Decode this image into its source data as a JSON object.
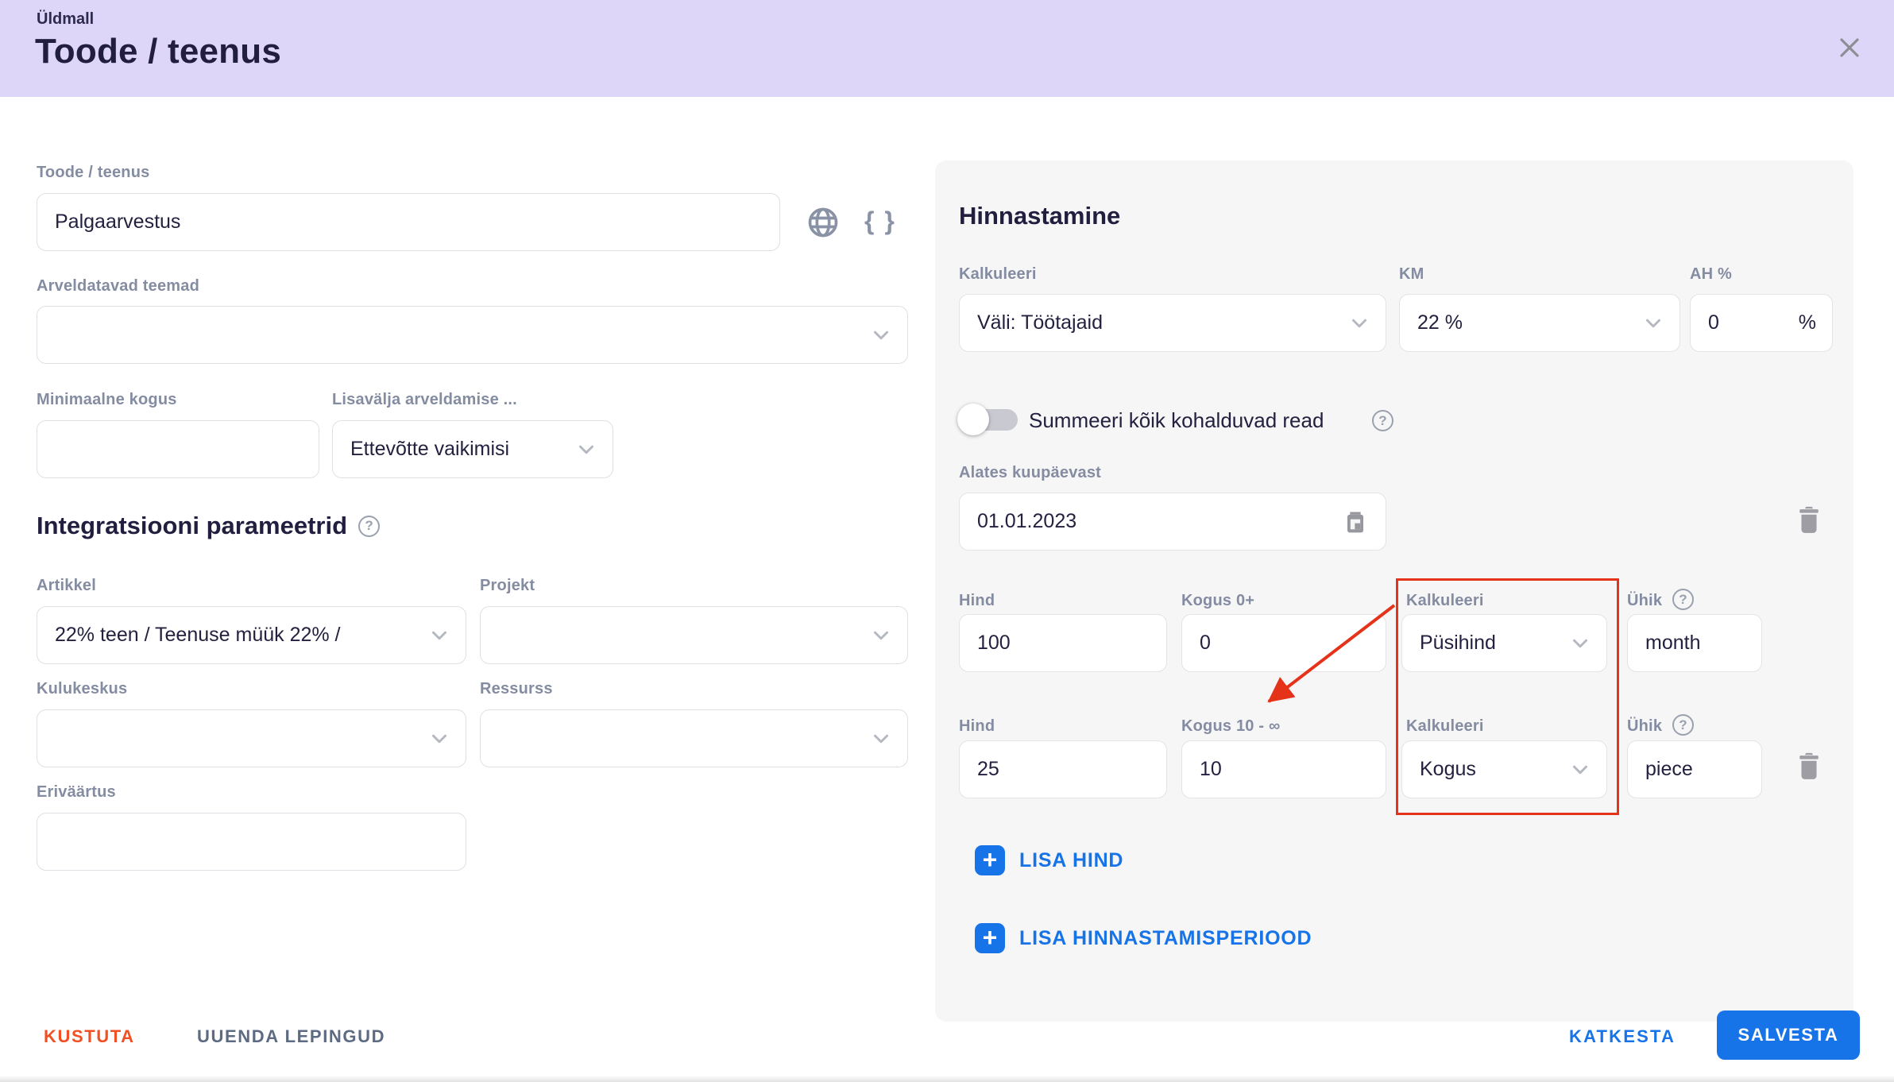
{
  "header": {
    "eyebrow": "Üldmall",
    "title": "Toode / teenus"
  },
  "icons": {
    "help_glyph": "?",
    "braces_glyph": "{ }"
  },
  "left_form": {
    "product_label": "Toode / teenus",
    "product_value": "Palgaarvestus",
    "billable_topics_label": "Arveldatavad teemad",
    "billable_topics_value": "",
    "min_quantity_label": "Minimaalne kogus",
    "min_quantity_value": "",
    "extra_field_label": "Lisavälja arveldamise ...",
    "extra_field_value": "Ettevõtte vaikimisi",
    "integration_heading": "Integratsiooni parameetrid",
    "artikkel_label": "Artikkel",
    "artikkel_value": "22% teen / Teenuse müük 22% /",
    "projekt_label": "Projekt",
    "projekt_value": "",
    "kulukeskus_label": "Kulukeskus",
    "kulukeskus_value": "",
    "ressurss_label": "Ressurss",
    "ressurss_value": "",
    "erivaartus_label": "Eriväärtus",
    "erivaartus_value": ""
  },
  "pricing": {
    "heading": "Hinnastamine",
    "kalkuleeri_label": "Kalkuleeri",
    "kalkuleeri_value": "Väli: Töötajaid",
    "km_label": "KM",
    "km_value": "22 %",
    "ah_label": "AH %",
    "ah_value": "0",
    "ah_suffix": "%",
    "toggle_label": "Summeeri kõik kohalduvad read",
    "date_label": "Alates kuupäevast",
    "date_value": "01.01.2023",
    "rows": [
      {
        "hind_label": "Hind",
        "hind": "100",
        "kogus_label": "Kogus 0+",
        "kogus": "0",
        "kalkuleeri_label": "Kalkuleeri",
        "kalkuleeri": "Püsihind",
        "yhik_label": "Ühik",
        "yhik": "month"
      },
      {
        "hind_label": "Hind",
        "hind": "25",
        "kogus_label": "Kogus 10 - ∞",
        "kogus": "10",
        "kalkuleeri_label": "Kalkuleeri",
        "kalkuleeri": "Kogus",
        "yhik_label": "Ühik",
        "yhik": "piece"
      }
    ],
    "add_price_label": "LISA HIND",
    "add_period_label": "LISA HINNASTAMISPERIOOD"
  },
  "footer": {
    "delete_label": "KUSTUTA",
    "update_contracts_label": "UUENDA LEPINGUD",
    "cancel_label": "KATKESTA",
    "save_label": "SALVESTA"
  },
  "colors": {
    "header_bg": "#ddd6f9",
    "accent_blue": "#1673e8",
    "delete_orange": "#f05023",
    "annotation_red": "#e5331a",
    "panel_bg": "#f6f6f7"
  }
}
